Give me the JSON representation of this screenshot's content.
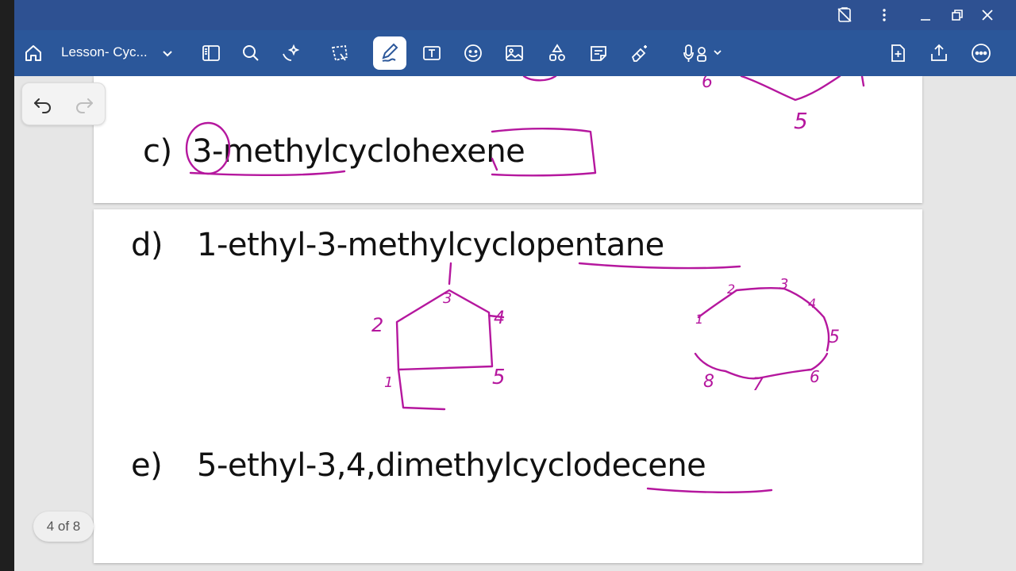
{
  "window": {
    "controls": [
      "no-touch-icon",
      "more-vert-icon",
      "minimize-icon",
      "restore-icon",
      "close-icon"
    ]
  },
  "toolbar": {
    "doc_title": "Lesson- Cyc...",
    "tools": [
      "home-icon",
      "page-view-icon",
      "search-icon",
      "sparkle-icon",
      "lasso-icon",
      "pen-icon",
      "text-box-icon",
      "sticker-icon",
      "image-icon",
      "shapes-icon",
      "note-icon",
      "eraser-magic-icon",
      "voice-record-icon",
      "add-page-icon",
      "share-icon",
      "more-icon"
    ],
    "active_tool": "pen-icon",
    "accent_color": "#2b579a",
    "titlebar_color": "#2e5192"
  },
  "ink_color": "#b5179e",
  "slides": {
    "c": {
      "letter": "c)",
      "name": "3-methylcyclohexene"
    },
    "d": {
      "letter": "d)",
      "name": "1-ethyl-3-methylcyclopentane"
    },
    "e": {
      "letter": "e)",
      "name": "5-ethyl-3,4,dimethylcyclodecene"
    }
  },
  "ink_labels": {
    "top": [
      "6",
      "5"
    ],
    "pentagon": [
      "3",
      "2",
      "4",
      "1",
      "5"
    ],
    "decagon": [
      "2",
      "3",
      "4",
      "1",
      "5",
      "8",
      "7",
      "6"
    ]
  },
  "page_indicator": "4 of 8"
}
